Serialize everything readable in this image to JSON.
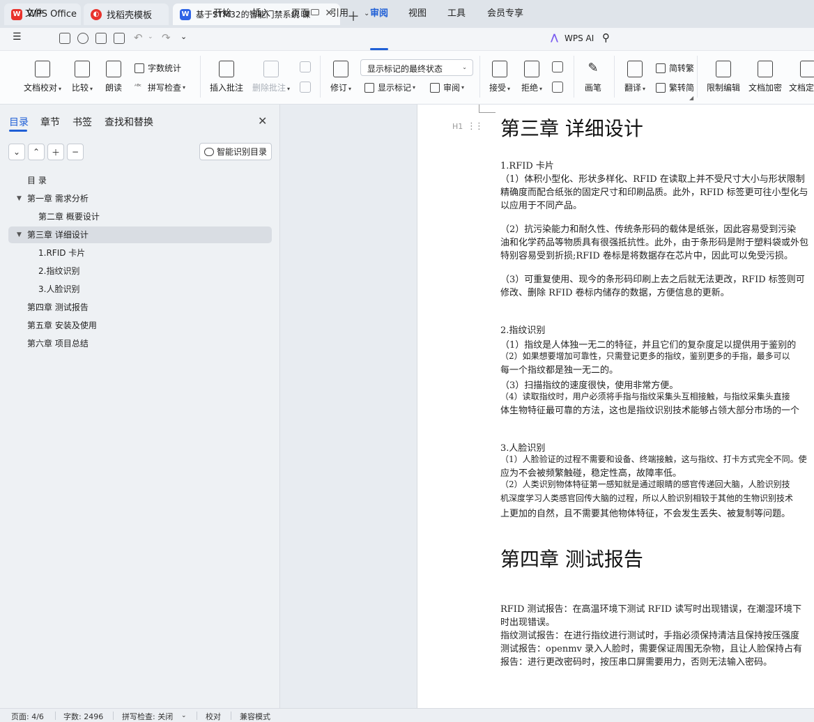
{
  "tabs": [
    {
      "label": "WPS Office",
      "icon": "wps-logo-icon"
    },
    {
      "label": "找稻壳模板",
      "icon": "docer-icon"
    },
    {
      "label": "基于STM32的智能门禁系统 课",
      "icon": "writer-icon"
    }
  ],
  "menu": {
    "file": "文件",
    "items": [
      "开始",
      "插入",
      "页面",
      "引用",
      "审阅",
      "视图",
      "工具",
      "会员专享"
    ],
    "active": "审阅",
    "wps_ai": "WPS AI"
  },
  "ribbon": {
    "doc_check": "文档校对",
    "compare": "比较",
    "read_aloud": "朗读",
    "word_count": "字数统计",
    "spell_check": "拼写检查",
    "insert_comment": "插入批注",
    "delete_comment": "删除批注",
    "revise": "修订",
    "display_state": "显示标记的最终状态",
    "show_markup": "显示标记",
    "review": "审阅",
    "accept": "接受",
    "reject": "拒绝",
    "pen": "画笔",
    "translate": "翻译",
    "to_traditional": "简转繁",
    "to_simplified": "繁转简",
    "restrict_edit": "限制编辑",
    "encrypt": "文档加密",
    "finalize": "文档定"
  },
  "panel": {
    "tabs": [
      "目录",
      "章节",
      "书签",
      "查找和替换"
    ],
    "smart_toc": "智能识别目录",
    "toc": [
      {
        "label": "目 录",
        "level": 1,
        "expandable": false
      },
      {
        "label": "第一章 需求分析",
        "level": 1,
        "expandable": true
      },
      {
        "label": "第二章 概要设计",
        "level": 2,
        "expandable": false
      },
      {
        "label": "第三章 详细设计",
        "level": 1,
        "expandable": true,
        "selected": true
      },
      {
        "label": "1.RFID 卡片",
        "level": 2,
        "expandable": false
      },
      {
        "label": "2.指纹识别",
        "level": 2,
        "expandable": false
      },
      {
        "label": "3.人脸识别",
        "level": 2,
        "expandable": false
      },
      {
        "label": "第四章 测试报告",
        "level": 1,
        "expandable": false
      },
      {
        "label": "第五章 安装及使用",
        "level": 1,
        "expandable": false
      },
      {
        "label": "第六章 项目总结",
        "level": 1,
        "expandable": false
      }
    ]
  },
  "document": {
    "h_ch3": "第三章 详细设计",
    "s1_title": "1.RFID 卡片",
    "s1_p1_l1": "（1）体积小型化、形状多样化、RFID 在读取上并不受尺寸大小与形状限制",
    "s1_p1_l2": "精确度而配合纸张的固定尺寸和印刷品质。此外，RFID 标签更可往小型化与",
    "s1_p1_l3": "以应用于不同产品。",
    "s1_p2_l1": "（2）抗污染能力和耐久性、传统条形码的载体是纸张，因此容易受到污染",
    "s1_p2_l2": "油和化学药品等物质具有很强抵抗性。此外，由于条形码是附于塑料袋或外包",
    "s1_p2_l3": "特别容易受到折损;RFID 卷标是将数据存在芯片中，因此可以免受污损。",
    "s1_p3_l1": "（3）可重复使用、现今的条形码印刷上去之后就无法更改，RFID 标签则可",
    "s1_p3_l2": "修改、删除 RFID 卷标内储存的数据，方便信息的更新。",
    "s2_title": "2.指纹识别",
    "s2_l1": "（1）指纹是人体独一无二的特征，并且它们的复杂度足以提供用于鉴别的",
    "s2_l2": "（2）如果想要增加可靠性，只需登记更多的指纹，鉴别更多的手指，最多可以",
    "s2_l3": "每一个指纹都是独一无二的。",
    "s2_l4": "（3）扫描指纹的速度很快，使用非常方便。",
    "s2_l5": "（4）读取指纹时，用户必须将手指与指纹采集头互相接触，与指纹采集头直接",
    "s2_l6": "体生物特征最可靠的方法，这也是指纹识别技术能够占领大部分市场的一个",
    "s3_title": "3.人脸识别",
    "s3_l1": "（1）人脸验证的过程不需要和设备、终端接触，这与指纹、打卡方式完全不同。使",
    "s3_l2": "应为不会被频繁触碰，稳定性高，故障率低。",
    "s3_l3": "（2）人类识别物体特征第一感知就是通过眼睛的感官传递回大脑，人脸识别技",
    "s3_l4": "机深度学习人类感官回传大脑的过程，所以人脸识别相较于其他的生物识别技术",
    "s3_l5": "上更加的自然，且不需要其他物体特征，不会发生丢失、被复制等问题。",
    "h_ch4": "第四章 测试报告",
    "r_l1": "RFID 测试报告：在高温环境下测试 RFID 读写时出现错误，在潮湿环境下",
    "r_l2": "时出现错误。",
    "r_l3": "指纹测试报告：在进行指纹进行测试时，手指必须保持清洁且保持按压强度",
    "r_l4": "测试报告：openmv 录入人脸时，需要保证周围无杂物，且让人脸保持占有",
    "r_l5": "报告：进行更改密码时，按压串口屏需要用力，否则无法输入密码。"
  },
  "status": {
    "page": "页面: 4/6",
    "words": "字数: 2496",
    "spell": "拼写检查: 关闭",
    "proof": "校对",
    "compat": "兼容模式"
  }
}
